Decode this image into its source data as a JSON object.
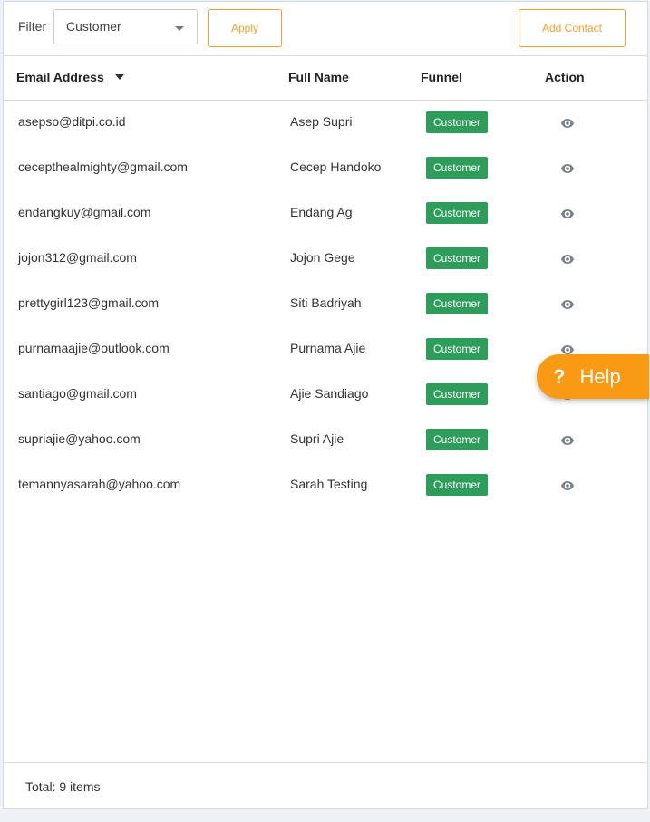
{
  "toolbar": {
    "filter_label": "Filter",
    "filter_value": "Customer",
    "apply_label": "Apply",
    "add_contact_label": "Add Contact"
  },
  "table": {
    "columns": [
      "Email Address",
      "Full Name",
      "Funnel",
      "Action"
    ],
    "rows": [
      {
        "email": "asepso@ditpi.co.id",
        "name": "Asep Supri",
        "funnel": "Customer"
      },
      {
        "email": "cecepthealmighty@gmail.com",
        "name": "Cecep Handoko",
        "funnel": "Customer"
      },
      {
        "email": "endangkuy@gmail.com",
        "name": "Endang Ag",
        "funnel": "Customer"
      },
      {
        "email": "jojon312@gmail.com",
        "name": "Jojon Gege",
        "funnel": "Customer"
      },
      {
        "email": "prettygirl123@gmail.com",
        "name": "Siti Badriyah",
        "funnel": "Customer"
      },
      {
        "email": "purnamaajie@outlook.com",
        "name": "Purnama Ajie",
        "funnel": "Customer"
      },
      {
        "email": "santiago@gmail.com",
        "name": "Ajie Sandiago",
        "funnel": "Customer"
      },
      {
        "email": "supriajie@yahoo.com",
        "name": "Supri Ajie",
        "funnel": "Customer"
      },
      {
        "email": "temannyasarah@yahoo.com",
        "name": "Sarah Testing",
        "funnel": "Customer"
      }
    ]
  },
  "footer": {
    "total": "Total: 9 items"
  },
  "help": {
    "question": "?",
    "label": "Help"
  },
  "colors": {
    "accent": "#f0a032",
    "badge": "#2e9d5b",
    "help": "#f99a14"
  },
  "icons": {
    "view": "eye-icon",
    "sort": "caret-down-icon",
    "dropdown": "chevron-down-icon"
  }
}
